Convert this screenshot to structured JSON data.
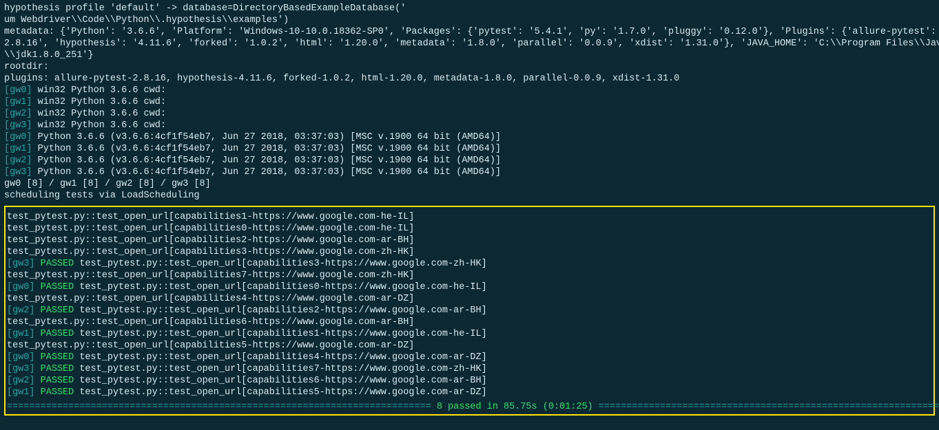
{
  "header": {
    "l1": "hypothesis profile 'default' -> database=DirectoryBasedExampleDatabase('",
    "l2": "um Webdriver\\\\Code\\\\Python\\\\.hypothesis\\\\examples')",
    "l3": "metadata: {'Python': '3.6.6', 'Platform': 'Windows-10-10.0.18362-SP0', 'Packages': {'pytest': '5.4.1', 'py': '1.7.0', 'pluggy': '0.12.0'}, 'Plugins': {'allure-pytest': '",
    "l4": "2.8.16', 'hypothesis': '4.11.6', 'forked': '1.0.2', 'html': '1.20.0', 'metadata': '1.8.0', 'parallel': '0.0.9', 'xdist': '1.31.0'}, 'JAVA_HOME': 'C:\\\\Program Files\\\\Java",
    "l5": "\\\\jdk1.8.0_251'}",
    "l6": "rootdir:",
    "l7": "plugins: allure-pytest-2.8.16, hypothesis-4.11.6, forked-1.0.2, html-1.20.0, metadata-1.8.0, parallel-0.0.9, xdist-1.31.0"
  },
  "cwd": [
    {
      "w": "[gw0]",
      "t": " win32 Python 3.6.6 cwd:"
    },
    {
      "w": "[gw1]",
      "t": " win32 Python 3.6.6 cwd:"
    },
    {
      "w": "[gw2]",
      "t": " win32 Python 3.6.6 cwd:"
    },
    {
      "w": "[gw3]",
      "t": " win32 Python 3.6.6 cwd:"
    }
  ],
  "pyver": [
    {
      "w": "[gw0]",
      "t": " Python 3.6.6 (v3.6.6:4cf1f54eb7, Jun 27 2018, 03:37:03) [MSC v.1900 64 bit (AMD64)]"
    },
    {
      "w": "[gw1]",
      "t": " Python 3.6.6 (v3.6.6:4cf1f54eb7, Jun 27 2018, 03:37:03) [MSC v.1900 64 bit (AMD64)]"
    },
    {
      "w": "[gw2]",
      "t": " Python 3.6.6 (v3.6.6:4cf1f54eb7, Jun 27 2018, 03:37:03) [MSC v.1900 64 bit (AMD64)]"
    },
    {
      "w": "[gw3]",
      "t": " Python 3.6.6 (v3.6.6:4cf1f54eb7, Jun 27 2018, 03:37:03) [MSC v.1900 64 bit (AMD64)]"
    }
  ],
  "sched": {
    "counts": "gw0 [8] / gw1 [8] / gw2 [8] / gw3 [8]",
    "msg": "scheduling tests via LoadScheduling"
  },
  "tests": [
    {
      "type": "plain",
      "text": "test_pytest.py::test_open_url[capabilities1-https://www.google.com-he-IL]"
    },
    {
      "type": "plain",
      "text": "test_pytest.py::test_open_url[capabilities0-https://www.google.com-he-IL]"
    },
    {
      "type": "plain",
      "text": "test_pytest.py::test_open_url[capabilities2-https://www.google.com-ar-BH]"
    },
    {
      "type": "plain",
      "text": "test_pytest.py::test_open_url[capabilities3-https://www.google.com-zh-HK]"
    },
    {
      "type": "pass",
      "worker": "[gw3]",
      "status": "PASSED",
      "rest": " test_pytest.py::test_open_url[capabilities3-https://www.google.com-zh-HK]"
    },
    {
      "type": "plain",
      "text": "test_pytest.py::test_open_url[capabilities7-https://www.google.com-zh-HK]"
    },
    {
      "type": "pass",
      "worker": "[gw0]",
      "status": "PASSED",
      "rest": " test_pytest.py::test_open_url[capabilities0-https://www.google.com-he-IL]"
    },
    {
      "type": "plain",
      "text": "test_pytest.py::test_open_url[capabilities4-https://www.google.com-ar-DZ]"
    },
    {
      "type": "pass",
      "worker": "[gw2]",
      "status": "PASSED",
      "rest": " test_pytest.py::test_open_url[capabilities2-https://www.google.com-ar-BH]"
    },
    {
      "type": "plain",
      "text": "test_pytest.py::test_open_url[capabilities6-https://www.google.com-ar-BH]"
    },
    {
      "type": "pass",
      "worker": "[gw1]",
      "status": "PASSED",
      "rest": " test_pytest.py::test_open_url[capabilities1-https://www.google.com-he-IL]"
    },
    {
      "type": "plain",
      "text": "test_pytest.py::test_open_url[capabilities5-https://www.google.com-ar-DZ]"
    },
    {
      "type": "pass",
      "worker": "[gw0]",
      "status": "PASSED",
      "rest": " test_pytest.py::test_open_url[capabilities4-https://www.google.com-ar-DZ]"
    },
    {
      "type": "pass",
      "worker": "[gw3]",
      "status": "PASSED",
      "rest": " test_pytest.py::test_open_url[capabilities7-https://www.google.com-zh-HK]"
    },
    {
      "type": "pass",
      "worker": "[gw2]",
      "status": "PASSED",
      "rest": " test_pytest.py::test_open_url[capabilities6-https://www.google.com-ar-BH]"
    },
    {
      "type": "pass",
      "worker": "[gw1]",
      "status": "PASSED",
      "rest": " test_pytest.py::test_open_url[capabilities5-https://www.google.com-ar-DZ]"
    }
  ],
  "summary": {
    "left_eq": "============================================================================ ",
    "text": "8 passed in 85.75s (0:01:25)",
    "right_eq": " ============================================================================"
  }
}
